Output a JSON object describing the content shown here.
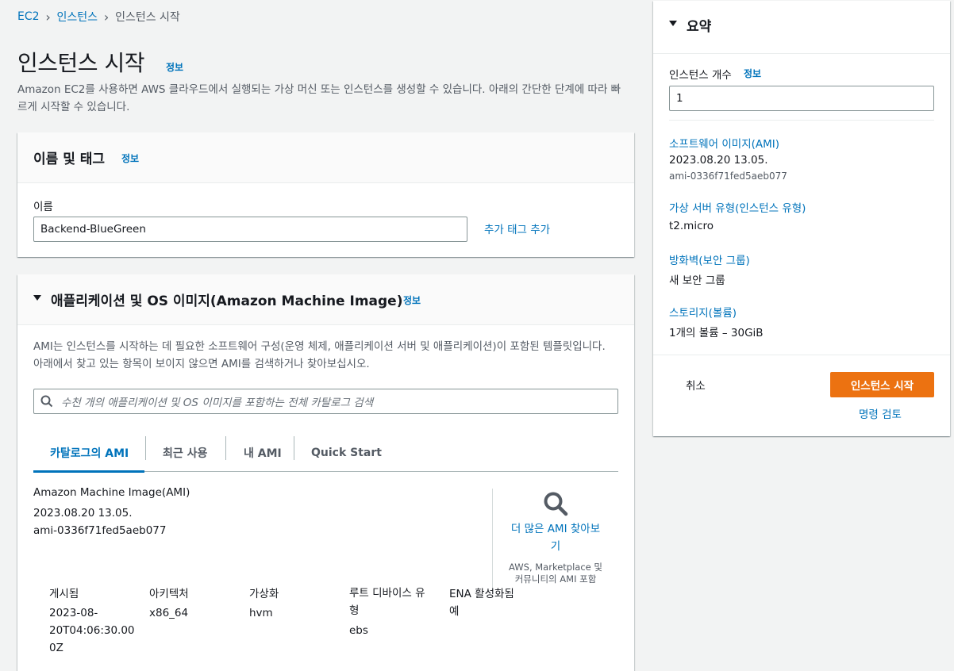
{
  "breadcrumb": {
    "item1": "EC2",
    "item2": "인스턴스",
    "current": "인스턴스 시작"
  },
  "page": {
    "title": "인스턴스 시작",
    "info": "정보",
    "description": "Amazon EC2를 사용하면 AWS 클라우드에서 실행되는 가상 머신 또는 인스턴스를 생성할 수 있습니다. 아래의 간단한 단계에 따라 빠르게 시작할 수 있습니다."
  },
  "name_tags": {
    "title": "이름 및 태그",
    "info": "정보",
    "name_label": "이름",
    "name_value": "Backend-BlueGreen",
    "add_tags": "추가 태그 추가"
  },
  "ami_section": {
    "title": "애플리케이션 및 OS 이미지(Amazon Machine Image)",
    "info": "정보",
    "description": "AMI는 인스턴스를 시작하는 데 필요한 소프트웨어 구성(운영 체제, 애플리케이션 서버 및 애플리케이션)이 포함된 템플릿입니다. 아래에서 찾고 있는 항목이 보이지 않으면 AMI를 검색하거나 찾아보십시오.",
    "search_placeholder": "수천 개의 애플리케이션 및 OS 이미지를 포함하는 전체 카탈로그 검색",
    "tabs": [
      "카탈로그의 AMI",
      "최근 사용",
      "내 AMI",
      "Quick Start"
    ],
    "active_tab": "카탈로그의 AMI",
    "ami_label": "Amazon Machine Image(AMI)",
    "ami_name": "2023.08.20 13.05.",
    "ami_id": "ami-0336f71fed5aeb077",
    "browse_more": "더 많은 AMI 찾아보기",
    "browse_more_line1": "더 많은 AMI 찾아보",
    "browse_more_line2": "기",
    "browse_sub": "AWS, Marketplace 및 커뮤니티의 AMI 포함",
    "browse_sub_line1": "AWS, Marketplace 및",
    "browse_sub_line2": "커뮤니티의 AMI 포함",
    "details": {
      "headers": [
        "게시됨",
        "아키텍처",
        "가상화",
        "루트 디바이스 유형",
        "ENA 활성화됨"
      ],
      "published_lines": [
        "2023-08-",
        "20T04:06:30.00",
        "0Z"
      ],
      "architecture": "x86_64",
      "virtualization": "hvm",
      "root_device_header_lines": [
        "루트 디바이스 유",
        "형"
      ],
      "root_device": "ebs",
      "ena": "예"
    }
  },
  "summary": {
    "title": "요약",
    "instance_count_label": "인스턴스 개수",
    "info": "정보",
    "instance_count": "1",
    "ami_link": "소프트웨어 이미지(AMI)",
    "ami_name": "2023.08.20 13.05.",
    "ami_id": "ami-0336f71fed5aeb077",
    "instance_type_link": "가상 서버 유형(인스턴스 유형)",
    "instance_type": "t2.micro",
    "firewall_link": "방화벽(보안 그룹)",
    "firewall_value": "새 보안 그룹",
    "storage_link": "스토리지(볼륨)",
    "storage_value": "1개의 볼륨 – 30GiB",
    "cancel": "취소",
    "launch": "인스턴스 시작",
    "review_commands": "명령 검토"
  },
  "colors": {
    "link": "#0073bb",
    "primary_button": "#ec7211",
    "background": "#f2f3f3"
  }
}
